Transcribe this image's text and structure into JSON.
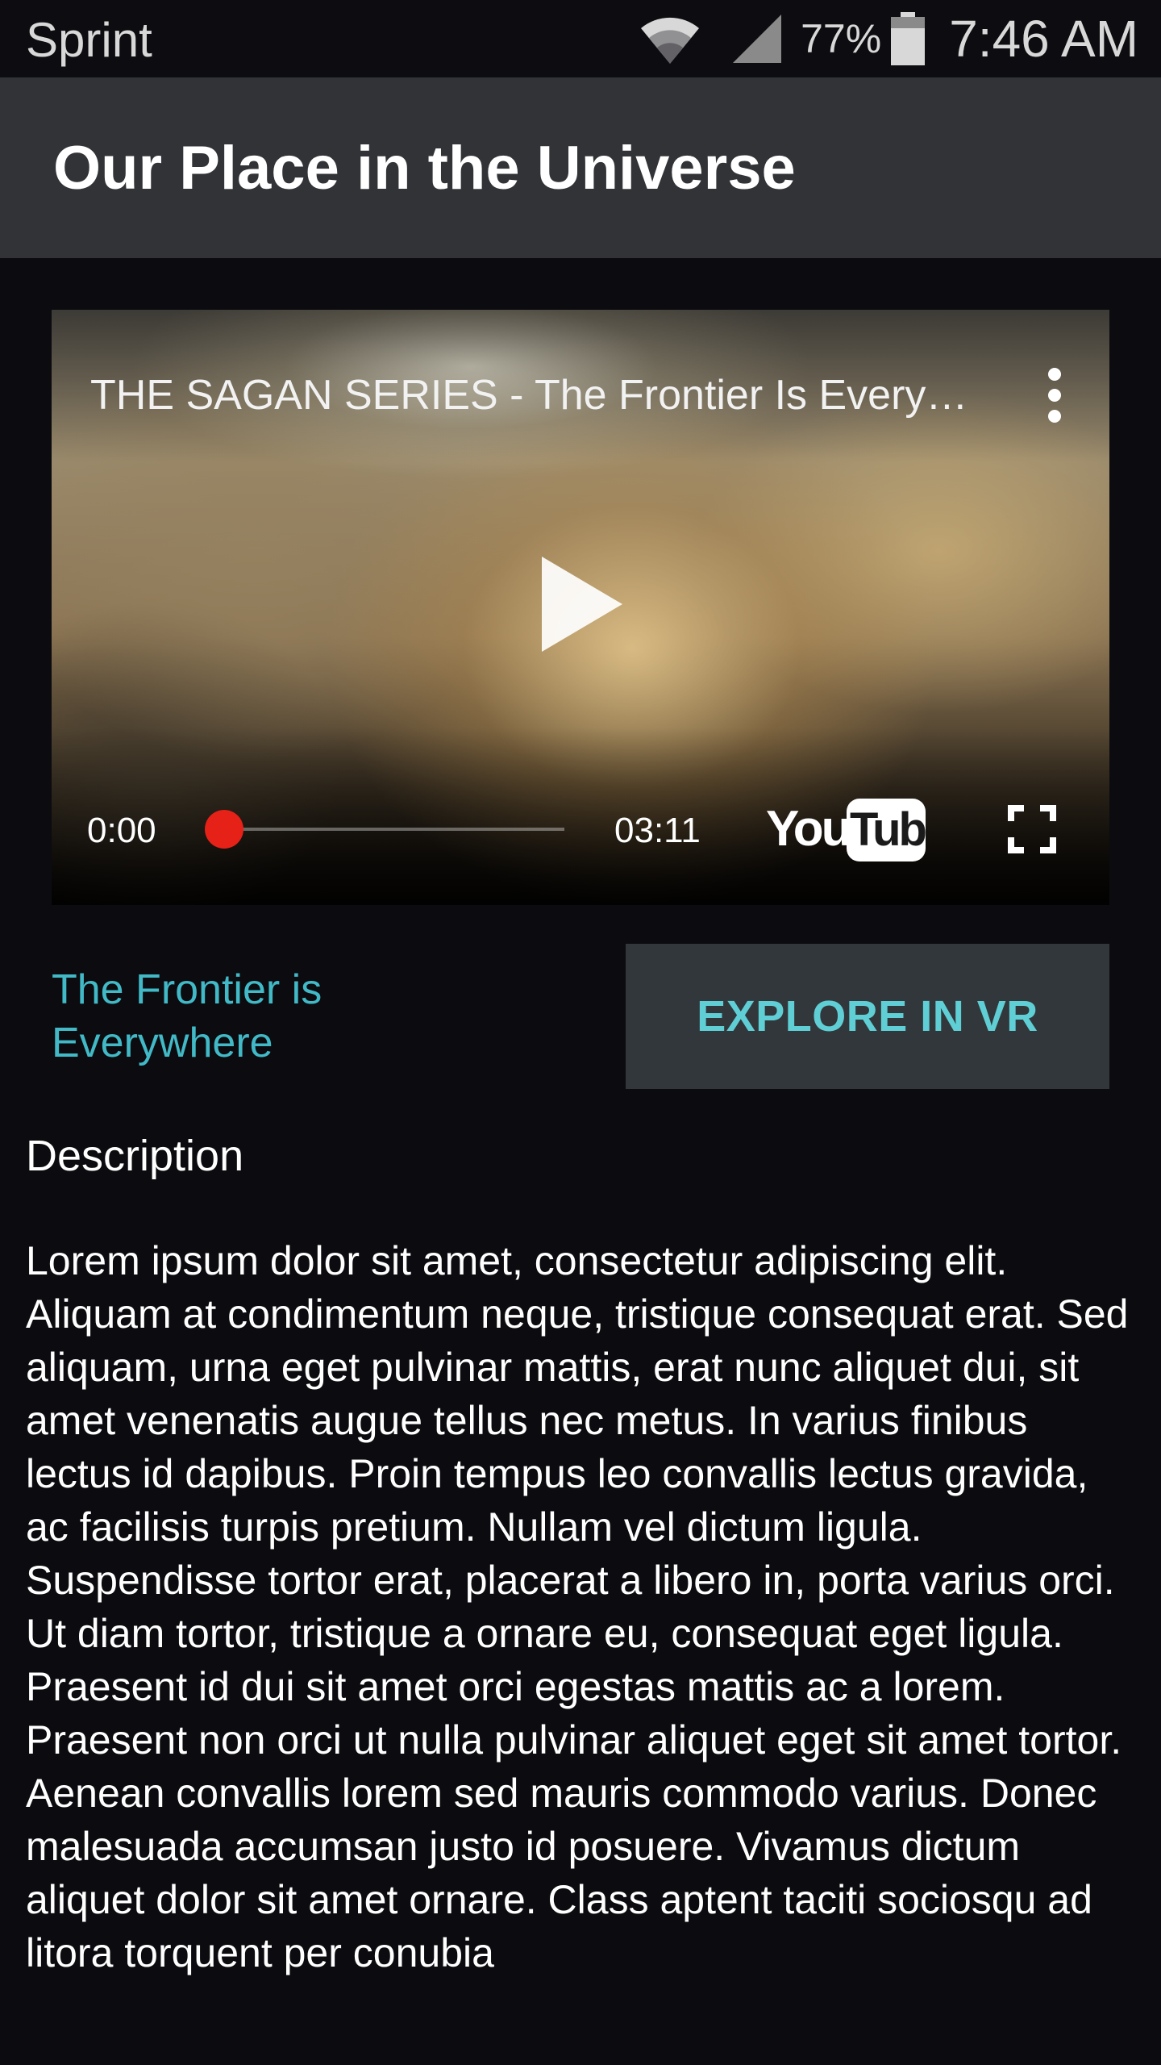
{
  "status_bar": {
    "carrier": "Sprint",
    "battery_percent": "77%",
    "time": "7:46 AM"
  },
  "app_bar": {
    "title": "Our Place in the Universe"
  },
  "video": {
    "title": "THE SAGAN SERIES - The Frontier Is Every…",
    "time_current": "0:00",
    "time_duration": "03:11",
    "progress": 0,
    "brand_logo": "YouTube"
  },
  "content": {
    "video_name": "The Frontier is Everywhere",
    "vr_button_label": "EXPLORE IN VR",
    "description_heading": "Description",
    "description_body": "Lorem ipsum dolor sit amet, consectetur adipiscing elit. Aliquam at condimentum neque, tristique consequat erat. Sed aliquam, urna eget pulvinar mattis, erat nunc aliquet dui, sit amet venenatis augue tellus nec metus. In varius finibus lectus id dapibus. Proin tempus leo convallis lectus gravida, ac facilisis turpis pretium. Nullam vel dictum ligula. Suspendisse tortor erat, placerat a libero in, porta varius orci. Ut diam tortor, tristique a ornare eu, consequat eget ligula. Praesent id dui sit amet orci egestas mattis ac a lorem. Praesent non orci ut nulla pulvinar aliquet eget sit amet tortor. Aenean convallis lorem sed mauris commodo varius. Donec malesuada accumsan justo id posuere. Vivamus dictum aliquet dolor sit amet ornare. Class aptent taciti sociosqu ad litora torquent per conubia"
  },
  "colors": {
    "background": "#0c0b0f",
    "app_bar": "#313336",
    "accent": "#41b9c6",
    "button_background": "#32373b",
    "seek_red": "#e62117"
  },
  "icons": [
    "wifi-icon",
    "cell-signal-icon",
    "battery-icon",
    "more-vert-icon",
    "play-icon",
    "youtube-logo",
    "fullscreen-icon"
  ]
}
